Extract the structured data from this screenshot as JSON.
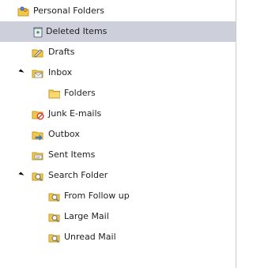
{
  "folder_tree": {
    "root": {
      "label": "Personal Folders",
      "icon": "personal-folders-icon"
    },
    "items": [
      {
        "label": "Deleted Items",
        "icon": "deleted-items-icon",
        "selected": true
      },
      {
        "label": "Drafts",
        "icon": "drafts-icon"
      },
      {
        "label": "Inbox",
        "icon": "inbox-icon",
        "expanded": true
      },
      {
        "label": "Folders",
        "icon": "folder-icon"
      },
      {
        "label": "Junk E-mails",
        "icon": "junk-email-icon"
      },
      {
        "label": "Outbox",
        "icon": "outbox-icon"
      },
      {
        "label": "Sent Items",
        "icon": "sent-items-icon"
      },
      {
        "label": "Search Folder",
        "icon": "search-folder-icon",
        "expanded": true
      },
      {
        "label": "From Follow up",
        "icon": "search-folder-icon"
      },
      {
        "label": "Large Mail",
        "icon": "search-folder-icon"
      },
      {
        "label": "Unread Mail",
        "icon": "search-folder-icon"
      }
    ]
  },
  "colors": {
    "selection": "#cdcfdb",
    "folder_yellow": "#f3c84a",
    "folder_outline": "#c79a22",
    "search_lens": "#7a7a7a",
    "junk_red": "#d23a2b"
  }
}
